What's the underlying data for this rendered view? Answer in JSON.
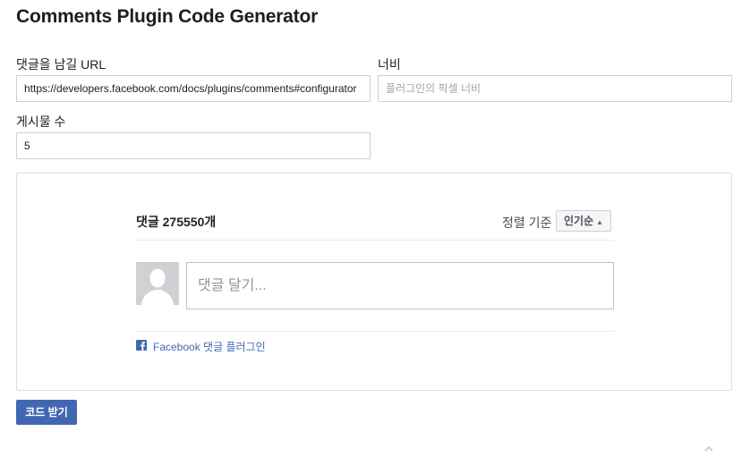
{
  "page": {
    "title": "Comments Plugin Code Generator"
  },
  "form": {
    "url_label": "댓글을 남길 URL",
    "url_value": "https://developers.facebook.com/docs/plugins/comments#configurator",
    "width_label": "너비",
    "width_placeholder": "플러그인의 픽셀 너비",
    "posts_label": "게시물 수",
    "posts_value": "5"
  },
  "preview": {
    "comment_count": "댓글 275550개",
    "sort_label": "정렬 기준",
    "sort_value": "인기순",
    "comment_placeholder": "댓글 달기...",
    "plugin_link": "Facebook 댓글 플러그인"
  },
  "actions": {
    "get_code_label": "코드 받기"
  },
  "colors": {
    "brand": "#4267b2",
    "border": "#ccd0d5",
    "avatar_bg": "#d0d1d5"
  },
  "icons": {
    "facebook": "facebook-icon",
    "sort": "sort-chevron-icon",
    "avatar": "default-avatar-icon",
    "scroll": "scroll-top-icon"
  }
}
